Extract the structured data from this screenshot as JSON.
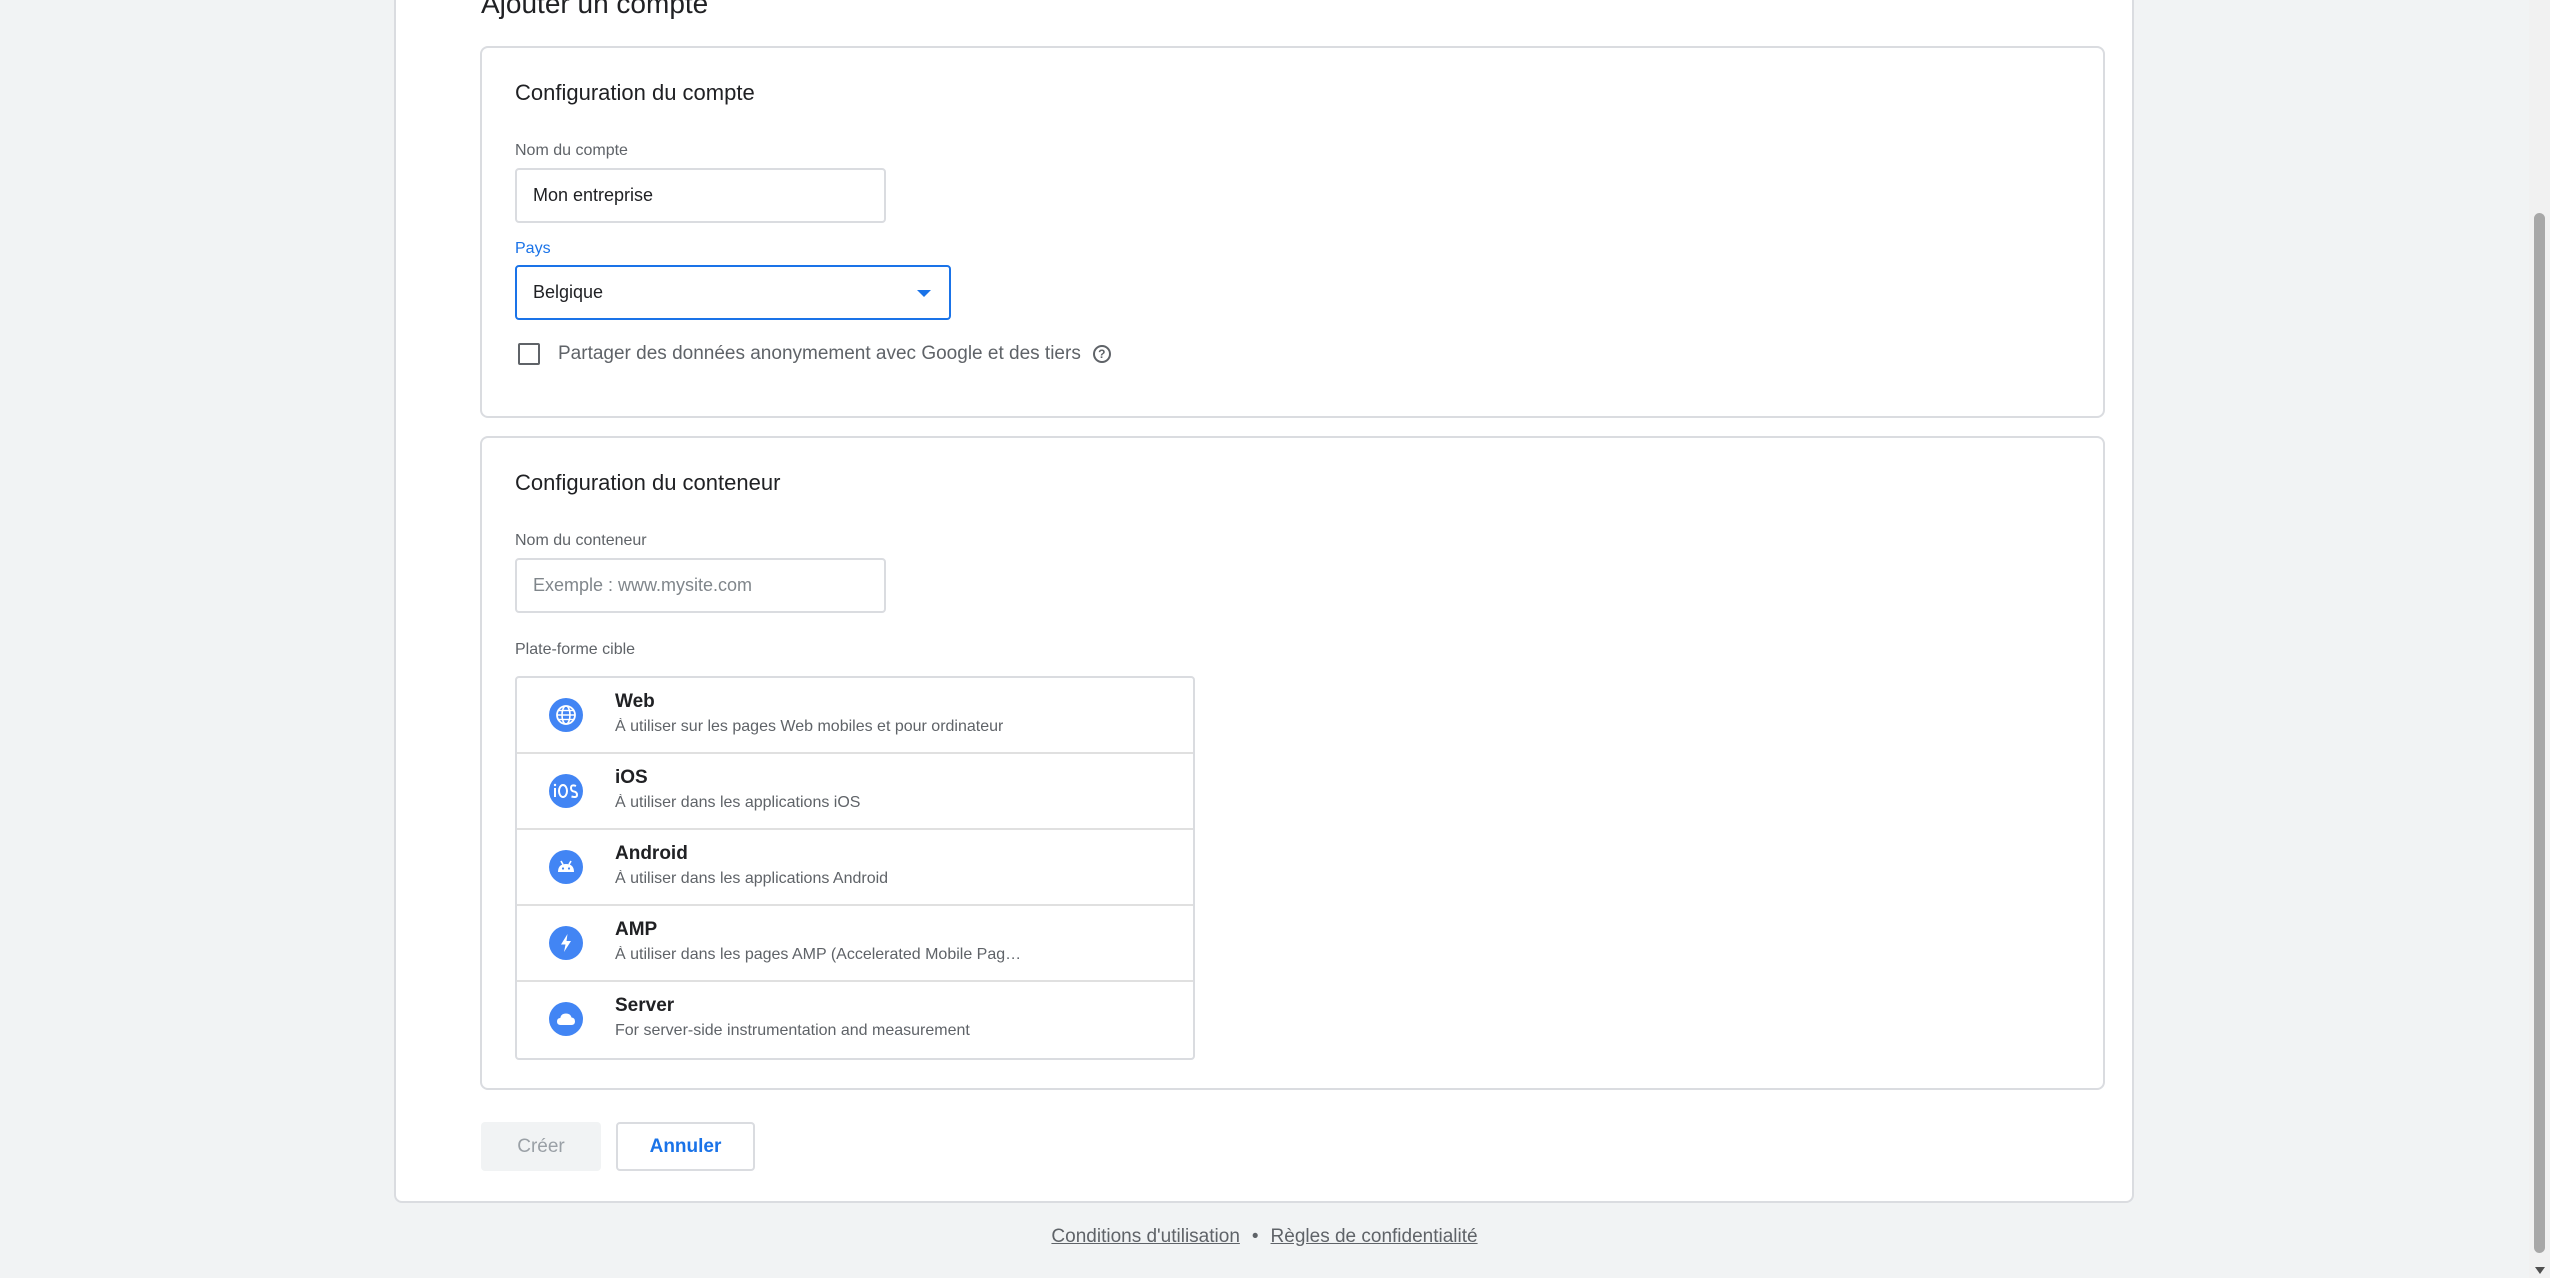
{
  "page": {
    "title": "Ajouter un compte"
  },
  "account_section": {
    "title": "Configuration du compte",
    "name_label": "Nom du compte",
    "name_value": "Mon entreprise",
    "country_label": "Pays",
    "country_value": "Belgique",
    "share_checkbox_label": "Partager des données anonymement avec Google et des tiers",
    "share_checked": false,
    "help_icon_glyph": "?"
  },
  "container_section": {
    "title": "Configuration du conteneur",
    "name_label": "Nom du conteneur",
    "name_placeholder": "Exemple : www.mysite.com",
    "platform_label": "Plate-forme cible",
    "platforms": [
      {
        "icon": "globe-icon",
        "name": "Web",
        "description": "À utiliser sur les pages Web mobiles et pour ordinateur"
      },
      {
        "icon": "ios-icon",
        "name": "iOS",
        "description": "À utiliser dans les applications iOS"
      },
      {
        "icon": "android-icon",
        "name": "Android",
        "description": "À utiliser dans les applications Android"
      },
      {
        "icon": "lightning-icon",
        "name": "AMP",
        "description": "À utiliser dans les pages AMP (Accelerated Mobile Pag…"
      },
      {
        "icon": "cloud-icon",
        "name": "Server",
        "description": "For server-side instrumentation and measurement"
      }
    ]
  },
  "actions": {
    "create_label": "Créer",
    "cancel_label": "Annuler"
  },
  "footer": {
    "terms_label": "Conditions d'utilisation",
    "separator": "•",
    "privacy_label": "Règles de confidentialité"
  },
  "colors": {
    "accent": "#1a73e8",
    "icon_blue": "#4285f4",
    "border": "#dadce0",
    "background": "#f1f3f4"
  }
}
